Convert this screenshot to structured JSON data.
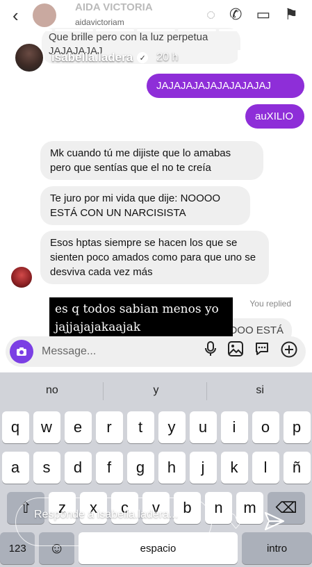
{
  "chat_header": {
    "name": "AIDA VICTORIA",
    "username": "aidavictoriam"
  },
  "story": {
    "username": "isabella.ladera",
    "time": "20 h",
    "more_label": "•••"
  },
  "previous_message": "Que brille pero con la luz perpetua JAJAJAJAJ",
  "outgoing": [
    {
      "text": "JAJAJAJAJAJAJAJAJAJ"
    },
    {
      "text": "auXILIO"
    }
  ],
  "incoming": [
    {
      "text": "Mk cuando tú me dijiste que lo amabas pero que sentías que el no te creía"
    },
    {
      "text": "Te juro por mi vida que dije: NOOOO ESTÁ CON UN NARCISISTA"
    },
    {
      "text": "Esos hptas siempre se hacen los que se sienten poco amados como para que uno se desviva cada vez más"
    }
  ],
  "you_replied": "You replied",
  "reply_preview": "OOO ESTÁ",
  "caption": {
    "line1": "es q todos sabian menos yo",
    "line2": "jajjajajakaajak"
  },
  "composer": {
    "placeholder": "Message..."
  },
  "keyboard": {
    "suggestions": [
      "no",
      "y",
      "si"
    ],
    "row1": [
      "q",
      "w",
      "e",
      "r",
      "t",
      "y",
      "u",
      "i",
      "o",
      "p"
    ],
    "row2": [
      "a",
      "s",
      "d",
      "f",
      "g",
      "h",
      "j",
      "k",
      "l",
      "ñ"
    ],
    "row3": [
      "z",
      "x",
      "c",
      "v",
      "b",
      "n",
      "m"
    ],
    "shift": "⇧",
    "backspace": "⌫",
    "numbers": "123",
    "emoji": "☺",
    "space": "espacio",
    "return": "intro"
  },
  "story_reply": {
    "placeholder": "Responde a isabella.ladera..."
  },
  "colors": {
    "outgoing": "#8e2ed8",
    "camera": "#7b3fe4",
    "incoming": "#efefef"
  }
}
